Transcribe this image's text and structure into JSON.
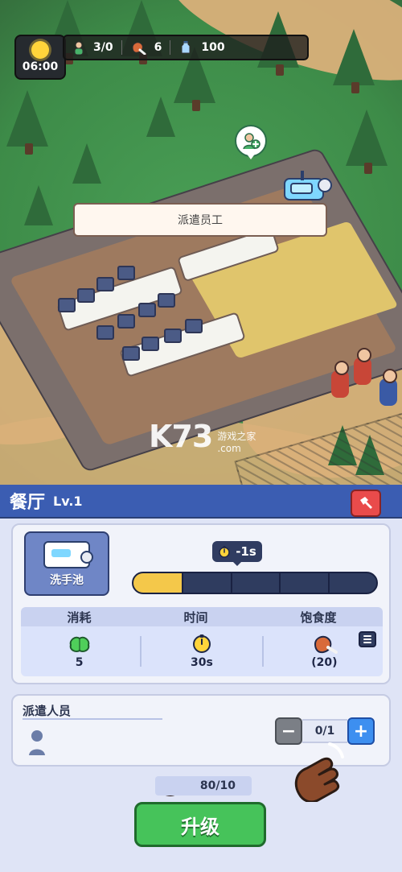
{
  "hud": {
    "time": "06:00",
    "workers": "3/0",
    "food": "6",
    "currency": "100"
  },
  "popup": {
    "dispatch_label": "派遣员工"
  },
  "watermark": {
    "logo": "K73",
    "subtitle_1": "游戏之家",
    "subtitle_2": ".com"
  },
  "panel": {
    "title": "餐厅",
    "level": "Lv.1",
    "facility_name": "洗手池",
    "time_delta": "-1s",
    "progress_fraction": 0.2,
    "stats": {
      "headers": [
        "消耗",
        "时间",
        "饱食度"
      ],
      "consume_value": "5",
      "time_value": "30s",
      "satiety_value": "(20)"
    },
    "staff": {
      "title": "派遣人员",
      "count": "0/1",
      "minus": "−",
      "plus": "+"
    },
    "cost": "80/10",
    "upgrade_label": "升级"
  }
}
